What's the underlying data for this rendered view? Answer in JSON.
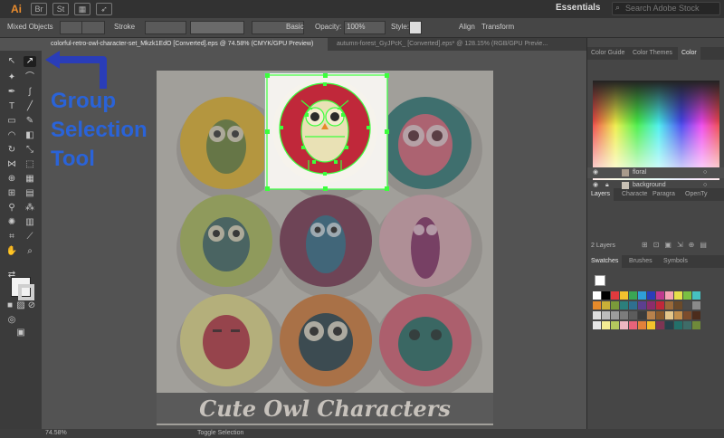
{
  "app": {
    "logo": "Ai",
    "top_icons": [
      "Br",
      "St"
    ],
    "workspace": "Essentials",
    "search_placeholder": "Search Adobe Stock"
  },
  "controlbar": {
    "object_type": "Mixed Objects",
    "stroke_label": "Stroke",
    "brush_label": "Basic",
    "opacity_label": "Opacity:",
    "opacity_value": "100%",
    "style_label": "Style:",
    "align_label": "Align",
    "transform_label": "Transform"
  },
  "tabs": [
    {
      "label": "colorful-retro-owl-character-set_Mkzk1EdO [Converted].eps @ 74.58% (CMYK/GPU Preview)",
      "active": true
    },
    {
      "label": "autumn-forest_GyJPcK_ [Converted].eps* @ 128.15% (RGB/GPU Previe...",
      "active": false
    }
  ],
  "callout": {
    "line1": "Group",
    "line2": "Selection",
    "line3": "Tool"
  },
  "artboard": {
    "banner_title": "Cute Owl Characters"
  },
  "panels": {
    "color_tabs": [
      "Color Guide",
      "Color Themes",
      "Color"
    ],
    "layers_tabs": [
      "Layers",
      "Characte",
      "Paragra",
      "OpenTy"
    ],
    "layers": [
      {
        "name": "floral",
        "selected": true
      },
      {
        "name": "background",
        "selected": false
      }
    ],
    "layers_count": "2 Layers",
    "swatches_tabs": [
      "Swatches",
      "Brushes",
      "Symbols"
    ]
  },
  "status": {
    "zoom": "74.58%",
    "mode": "Toggle Selection"
  },
  "colors": {
    "accent_arrow": "#2a3db8",
    "callout_text": "#2a63d8",
    "selection_green": "#3cff3c",
    "owl_red": "#c0283a"
  }
}
